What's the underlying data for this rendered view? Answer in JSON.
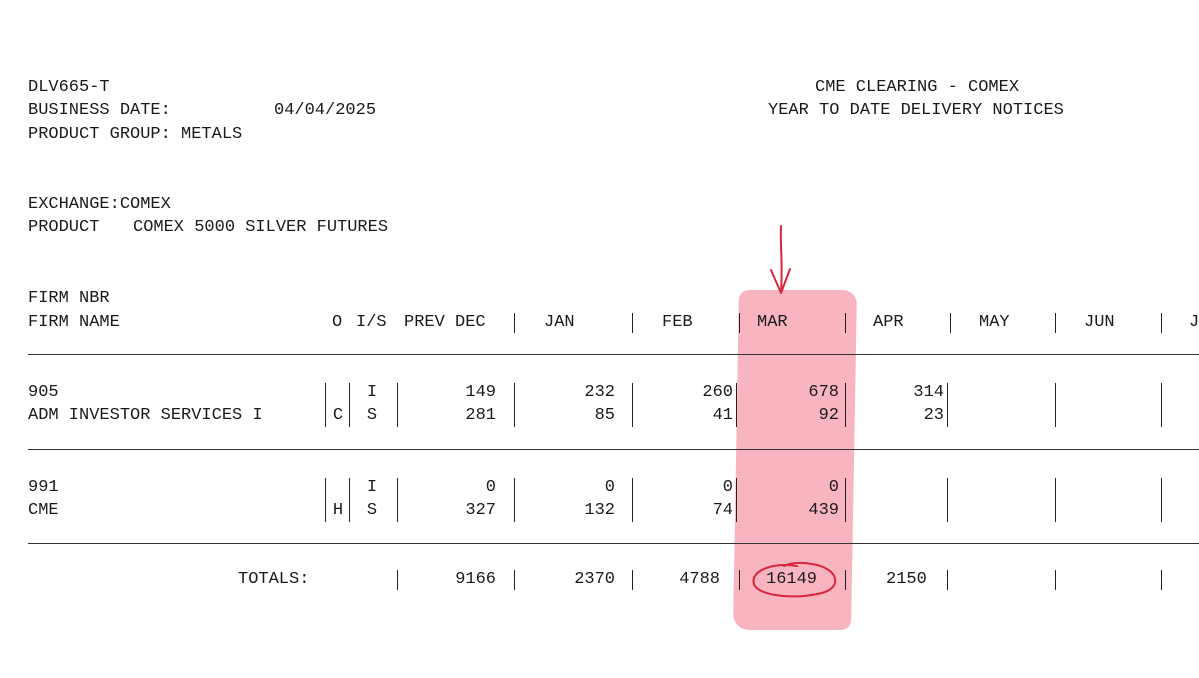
{
  "header": {
    "report_id": "DLV665-T",
    "business_date_label": "BUSINESS DATE:",
    "business_date": "04/04/2025",
    "product_group": "PRODUCT GROUP: METALS",
    "clearing_title": "CME CLEARING - COMEX",
    "report_title": "YEAR TO DATE DELIVERY NOTICES"
  },
  "exchange": {
    "exchange_line": "EXCHANGE:COMEX",
    "product_label": "PRODUCT",
    "product_name": "COMEX 5000 SILVER FUTURES"
  },
  "columns": {
    "firm_nbr": "FIRM NBR",
    "firm_name": "FIRM NAME",
    "o": "O",
    "is": "I/S",
    "prev": "PREV DEC",
    "jan": "JAN",
    "feb": "FEB",
    "mar": "MAR",
    "apr": "APR",
    "may": "MAY",
    "jun": "JUN",
    "jul_partial": "J"
  },
  "firms": [
    {
      "nbr": "905",
      "name": "ADM INVESTOR SERVICES I",
      "o": "C",
      "issued": {
        "is": "I",
        "prev": "149",
        "jan": "232",
        "feb": "260",
        "mar": "678",
        "apr": "314"
      },
      "stopped": {
        "is": "S",
        "prev": "281",
        "jan": "85",
        "feb": "41",
        "mar": "92",
        "apr": "23"
      }
    },
    {
      "nbr": "991",
      "name": "CME",
      "o": "H",
      "issued": {
        "is": "I",
        "prev": "0",
        "jan": "0",
        "feb": "0",
        "mar": "0"
      },
      "stopped": {
        "is": "S",
        "prev": "327",
        "jan": "132",
        "feb": "74",
        "mar": "439"
      }
    }
  ],
  "totals": {
    "label": "TOTALS:",
    "prev": "9166",
    "jan": "2370",
    "feb": "4788",
    "mar": "16149",
    "apr": "2150"
  },
  "annotations": {
    "highlight_color": "#f2788c",
    "ink_color": "#d8263c"
  }
}
